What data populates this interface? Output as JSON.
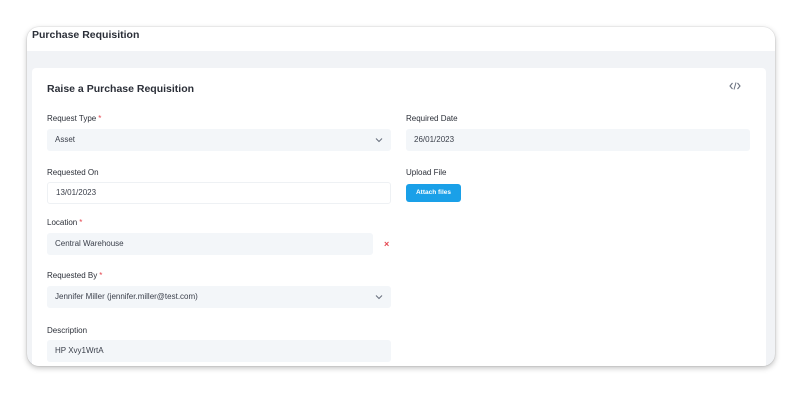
{
  "page": {
    "title": "Purchase Requisition"
  },
  "card": {
    "title": "Raise a Purchase Requisition"
  },
  "icons": {
    "embed": "code-icon",
    "clear": "close-icon",
    "dropdown": "chevron-down-icon"
  },
  "form": {
    "request_type": {
      "label": "Request Type",
      "value": "Asset",
      "required": "*"
    },
    "required_date": {
      "label": "Required Date",
      "value": "26/01/2023"
    },
    "requested_on": {
      "label": "Requested On",
      "value": "13/01/2023"
    },
    "upload_file": {
      "label": "Upload File",
      "button_label": "Attach files"
    },
    "location": {
      "label": "Location",
      "value": "Central Warehouse",
      "required": "*",
      "clear": "×"
    },
    "requested_by": {
      "label": "Requested By",
      "value": "Jennifer Miller (jennifer.miller@test.com)",
      "required": "*"
    },
    "description": {
      "label": "Description",
      "value": "HP Xvy1WrtA"
    }
  },
  "colors": {
    "accent": "#1aa0e8",
    "required": "#e5454f",
    "field_bg": "#f3f6f9"
  }
}
